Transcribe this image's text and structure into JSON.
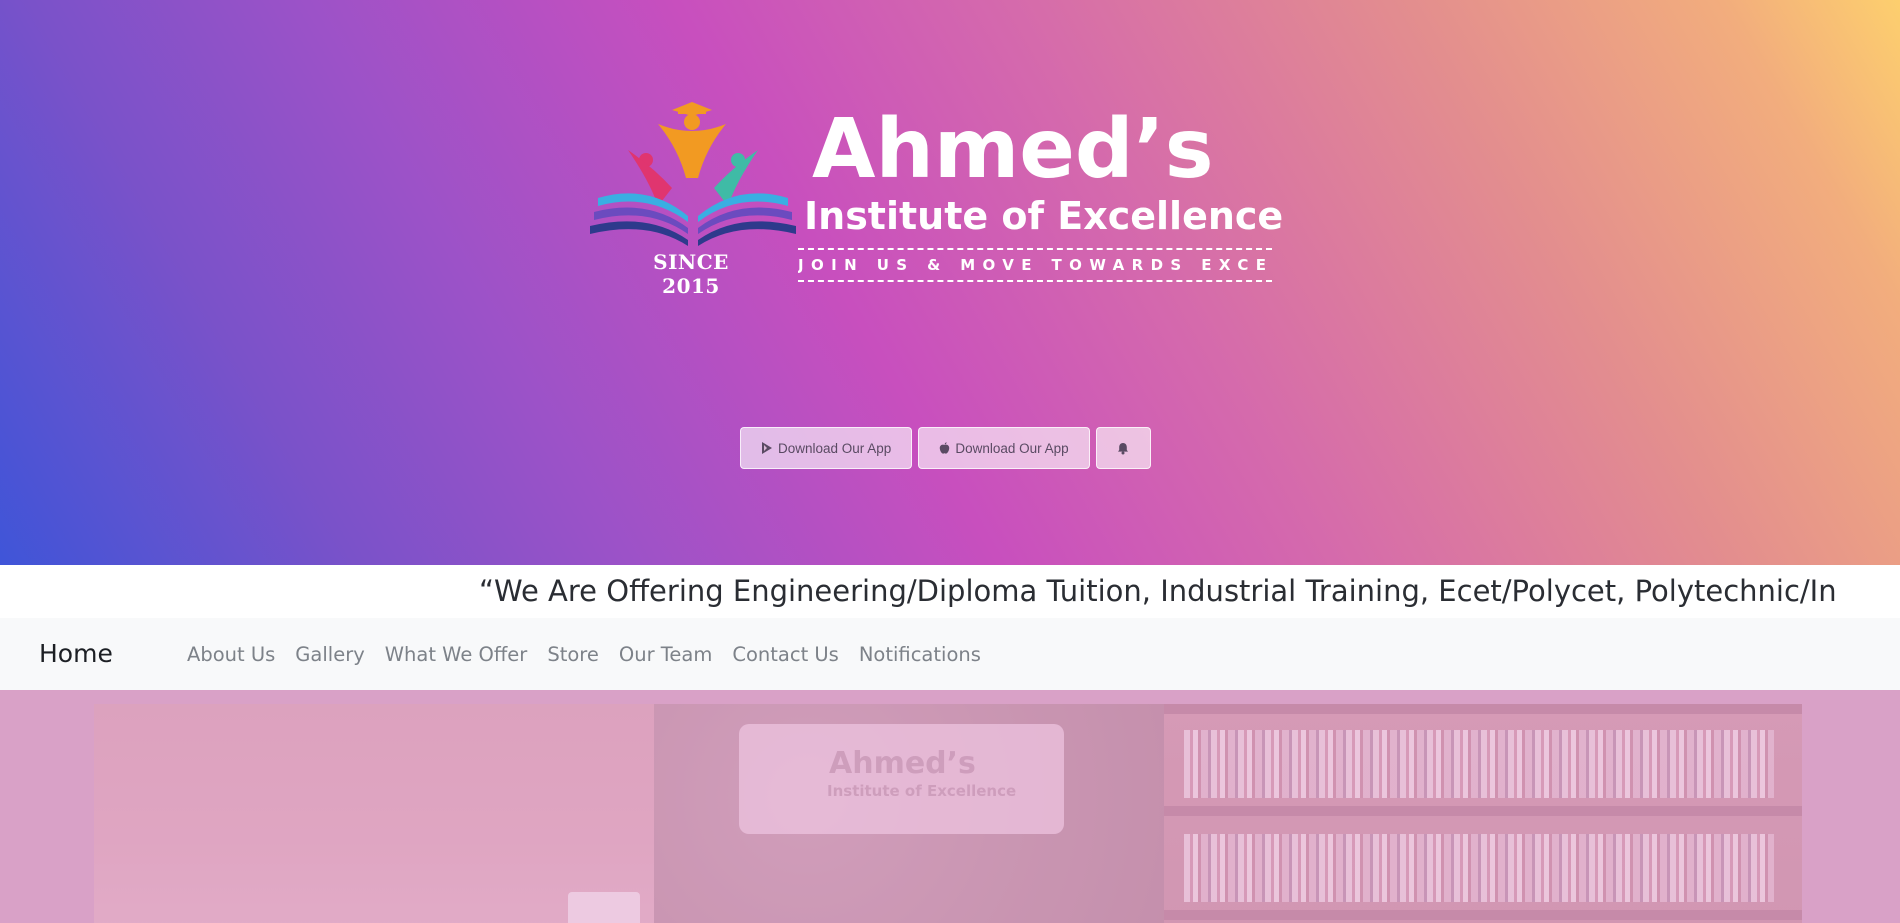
{
  "hero": {
    "logo": {
      "since": "SINCE 2015",
      "name": "Ahmed’s",
      "subtitle": "Institute of Excellence",
      "tagline": "JOIN US & MOVE TOWARDS EXCELLENCE"
    },
    "buttons": [
      {
        "label": "Download Our App",
        "icon": "google-play-icon"
      },
      {
        "label": "Download Our App",
        "icon": "apple-icon"
      },
      {
        "label": "",
        "icon": "bell-icon"
      }
    ]
  },
  "marquee": {
    "text": "“We Are Offering Engineering/Diploma Tuition, Industrial Training, Ecet/Polycet, Polytechnic/In"
  },
  "nav": {
    "brand": "Home",
    "items": [
      "About Us",
      "Gallery",
      "What We Offer",
      "Store",
      "Our Team",
      "Contact Us",
      "Notifications"
    ]
  },
  "colors": {
    "gradient_start": "#3f55d8",
    "gradient_mid": "#c84fbe",
    "gradient_end": "#fdcf6e",
    "nav_bg": "#f8f9fa",
    "photo_tint": "#d9a1c7"
  }
}
